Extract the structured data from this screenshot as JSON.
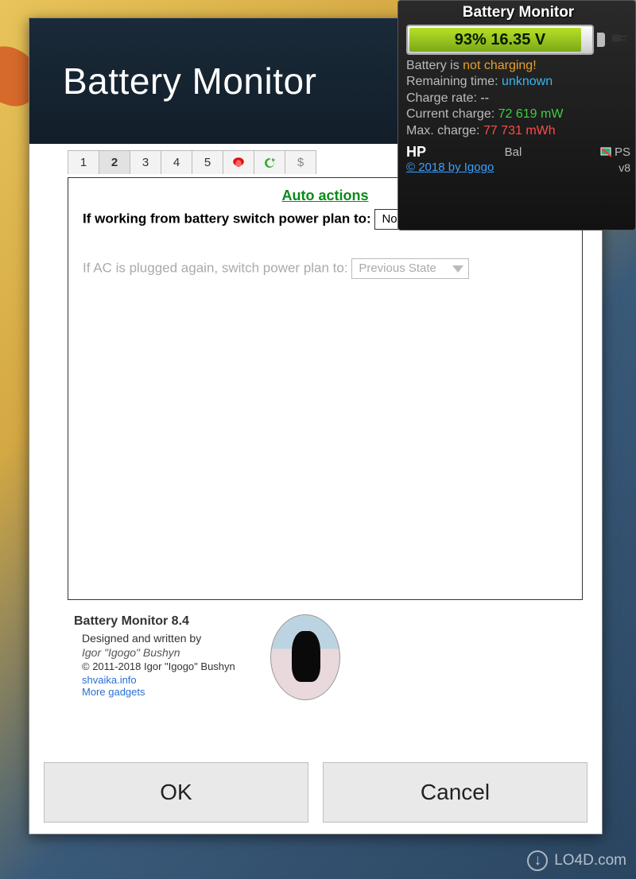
{
  "dialog": {
    "title": "Battery Monitor",
    "tabs": [
      "1",
      "2",
      "3",
      "4",
      "5"
    ],
    "active_tab_index": 1,
    "section_title": "Auto actions",
    "battery_label": "If working from battery switch power plan to:",
    "battery_select_value": "None",
    "ac_label": "If AC is plugged again, switch power plan to:",
    "ac_select_value": "Previous State",
    "about": {
      "product": "Battery Monitor 8.4",
      "designed": "Designed and written by",
      "author": "Igor \"Igogo\" Bushyn",
      "copyright": "© 2011-2018 Igor \"Igogo\" Bushyn",
      "link1": "shvaika.info",
      "link2": "More gadgets"
    },
    "ok": "OK",
    "cancel": "Cancel"
  },
  "widget": {
    "title": "Battery Monitor",
    "percent": "93%",
    "voltage": "16.35 V",
    "status_label": "Battery is ",
    "status_value": "not charging!",
    "remaining_label": "Remaining time: ",
    "remaining_value": "unknown",
    "rate_label": "Charge rate: ",
    "rate_value": "--",
    "current_label": "Current charge: ",
    "current_value": "72 619 mW",
    "max_label": "Max. charge: ",
    "max_value": "77 731 mWh",
    "hp": "HP",
    "bal": "Bal",
    "ps": "PS",
    "version": "v8",
    "credit": "© 2018 by Igogo"
  },
  "watermark": "LO4D.com"
}
